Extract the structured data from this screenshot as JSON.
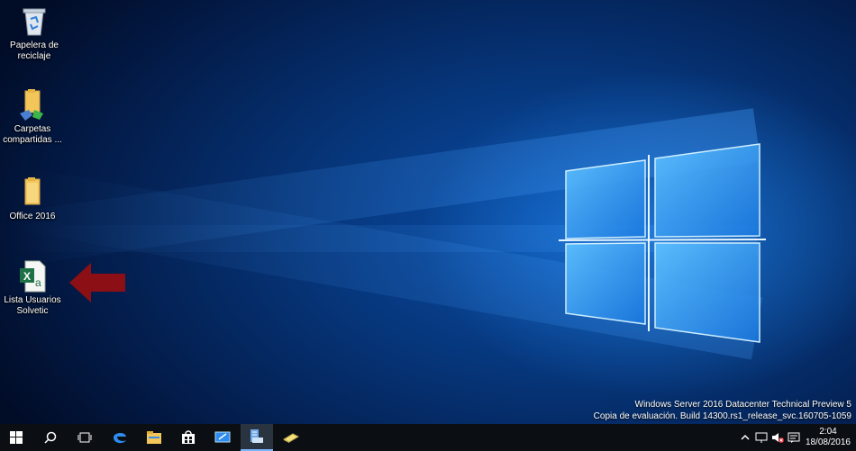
{
  "desktop": {
    "icons": [
      {
        "label": "Papelera de reciclaje",
        "icon": "recycle-bin-icon"
      },
      {
        "label": "Carpetas compartidas ...",
        "icon": "shared-folder-icon"
      },
      {
        "label": "Office 2016",
        "icon": "folder-icon"
      },
      {
        "label": "Lista Usuarios Solvetic",
        "icon": "excel-file-icon"
      }
    ],
    "arrow_color": "#8b0f14"
  },
  "watermark": {
    "line1": "Windows Server 2016 Datacenter Technical Preview 5",
    "line2": "Copia de evaluación. Build 14300.rs1_release_svc.160705-1059"
  },
  "taskbar": {
    "buttons": [
      "start-icon",
      "search-icon",
      "task-view-icon",
      "edge-icon",
      "file-explorer-icon",
      "store-icon",
      "remote-desktop-icon",
      "server-manager-icon",
      "eraser-app-icon"
    ],
    "tray": [
      "chevron-up-icon",
      "network-icon",
      "volume-muted-icon",
      "notifications-icon"
    ],
    "clock_time": "2:04",
    "clock_date": "18/08/2016"
  },
  "colors": {
    "accent": "#1e90ff",
    "taskbar_bg": "#0b0f14"
  }
}
